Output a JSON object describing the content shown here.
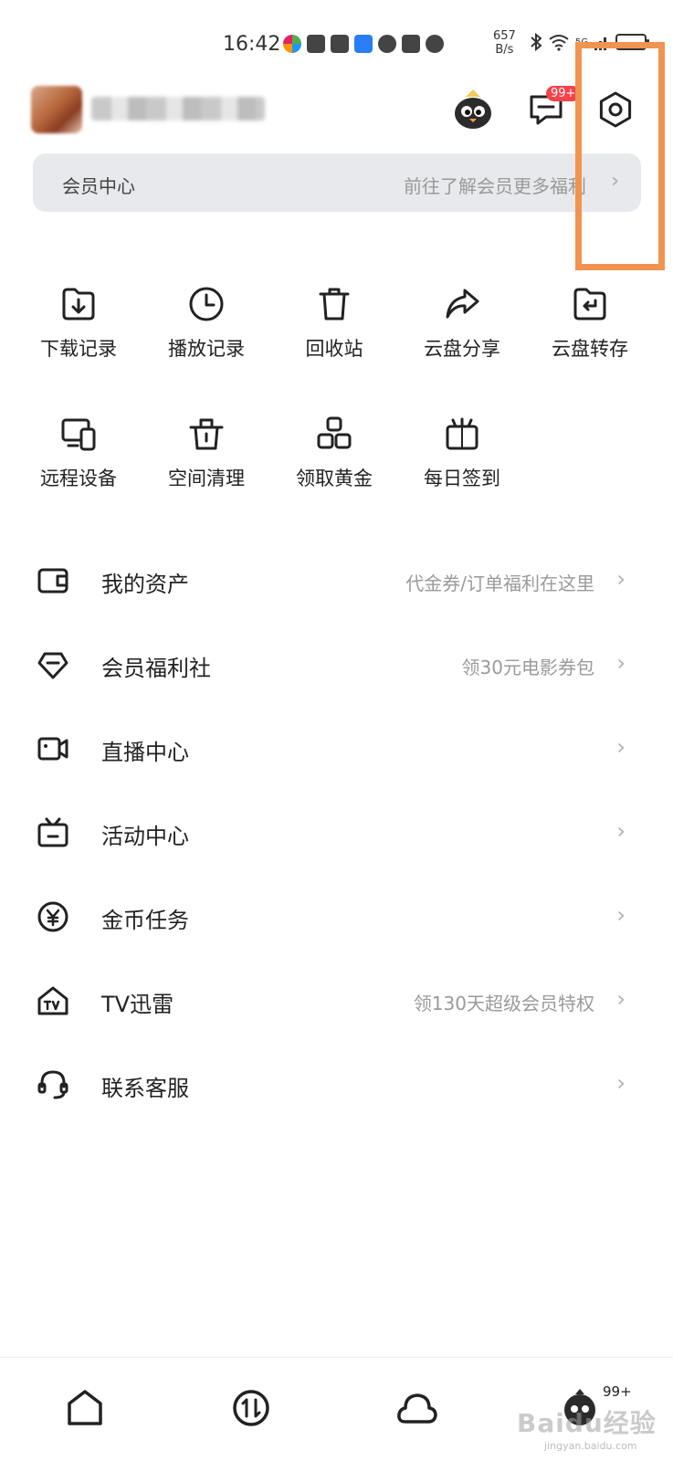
{
  "status_bar": {
    "time": "16:42",
    "speed_value": "657",
    "speed_unit": "B/s",
    "network": "5G"
  },
  "header": {
    "message_badge": "99+"
  },
  "member_banner": {
    "title": "会员中心",
    "more": "前往了解会员更多福利",
    "chevron": "›"
  },
  "grid": [
    {
      "label": "下载记录",
      "icon": "download-icon"
    },
    {
      "label": "播放记录",
      "icon": "clock-icon"
    },
    {
      "label": "回收站",
      "icon": "trash-icon"
    },
    {
      "label": "云盘分享",
      "icon": "share-icon"
    },
    {
      "label": "云盘转存",
      "icon": "transfer-icon"
    },
    {
      "label": "远程设备",
      "icon": "devices-icon"
    },
    {
      "label": "空间清理",
      "icon": "cleanup-icon"
    },
    {
      "label": "领取黄金",
      "icon": "gold-icon"
    },
    {
      "label": "每日签到",
      "icon": "gift-icon"
    }
  ],
  "list": [
    {
      "label": "我的资产",
      "hint": "代金券/订单福利在这里",
      "icon": "wallet-icon"
    },
    {
      "label": "会员福利社",
      "hint": "领30元电影券包",
      "icon": "diamond-icon"
    },
    {
      "label": "直播中心",
      "hint": "",
      "icon": "video-icon"
    },
    {
      "label": "活动中心",
      "hint": "",
      "icon": "tv-box-icon"
    },
    {
      "label": "金币任务",
      "hint": "",
      "icon": "coin-icon"
    },
    {
      "label": "TV迅雷",
      "hint": "领130天超级会员特权",
      "icon": "tv-house-icon"
    },
    {
      "label": "联系客服",
      "hint": "",
      "icon": "headset-icon"
    }
  ],
  "list_chevron": "›",
  "bottom_nav": {
    "badge": "99+",
    "watermark": "Baidu经验",
    "watermark_sub": "jingyan.baidu.com"
  },
  "colors": {
    "highlight": "#f0944f",
    "badge": "#f4424b",
    "banner_bg": "#e7e9ed"
  }
}
